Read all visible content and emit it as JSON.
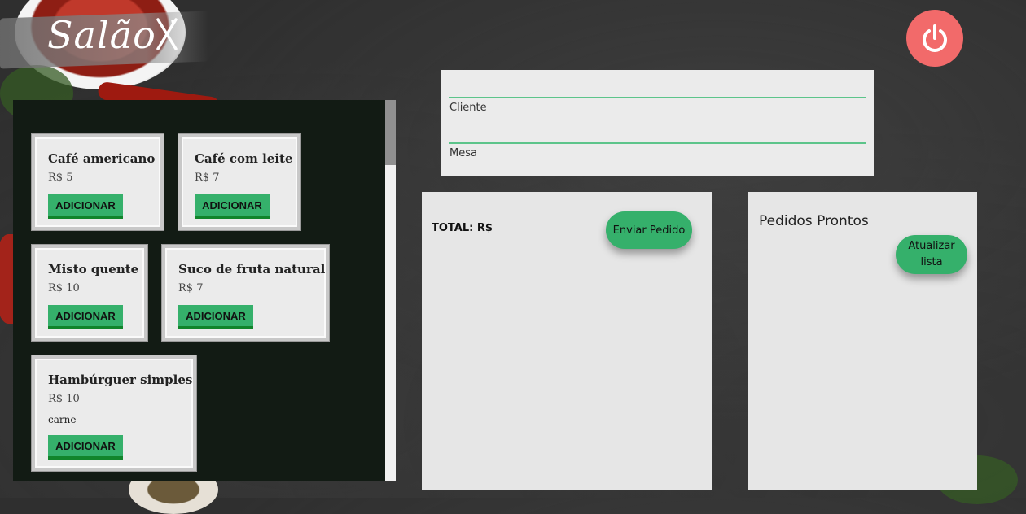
{
  "logo": {
    "text": "Salão",
    "utensils": "ꭗ"
  },
  "menu": {
    "items": [
      {
        "name": "Café americano",
        "price": "R$ 5",
        "description": "",
        "add_label": "ADICIONAR"
      },
      {
        "name": "Café com leite",
        "price": "R$ 7",
        "description": "",
        "add_label": "ADICIONAR"
      },
      {
        "name": "Misto quente",
        "price": "R$ 10",
        "description": "",
        "add_label": "ADICIONAR"
      },
      {
        "name": "Suco de fruta natural",
        "price": "R$ 7",
        "description": "",
        "add_label": "ADICIONAR"
      },
      {
        "name": "Hambúrguer simples",
        "price": "R$ 10",
        "description": "carne",
        "add_label": "ADICIONAR"
      }
    ]
  },
  "form": {
    "client_label": "Cliente",
    "table_label": "Mesa"
  },
  "order": {
    "total_label": "TOTAL: R$",
    "send_label": "Enviar Pedido"
  },
  "ready": {
    "title": "Pedidos Prontos",
    "refresh_label": "Atualizar lista"
  },
  "colors": {
    "accent": "#35b06b",
    "power": "#f26a6a",
    "panel": "#e6e6e6"
  }
}
